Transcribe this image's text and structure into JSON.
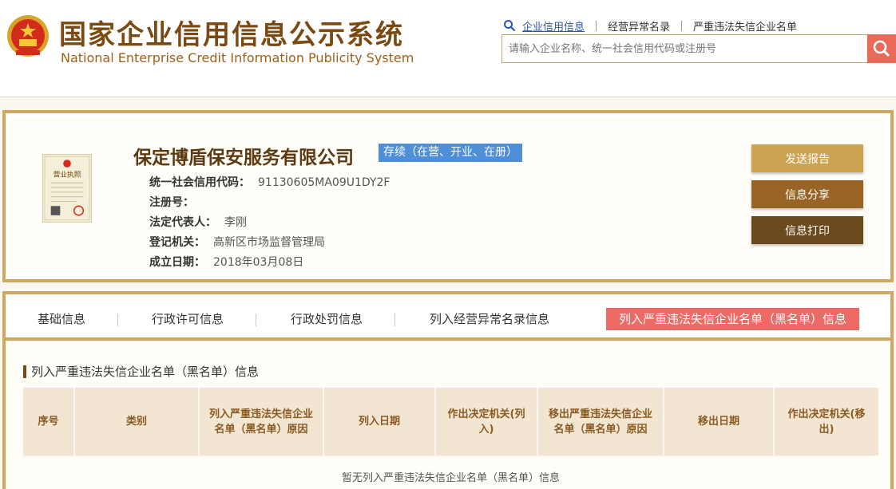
{
  "header": {
    "title_cn": "国家企业信用信息公示系统",
    "title_en": "National Enterprise Credit Information Publicity System",
    "links": [
      "企业信用信息",
      "经营异常名录",
      "严重违法失信企业名单"
    ],
    "search": {
      "placeholder": "请输入企业名称、统一社会信用代码或注册号"
    }
  },
  "company": {
    "name": "保定博盾保安服务有限公司",
    "status": "存续（在营、开业、在册）",
    "fields": [
      {
        "label": "统一社会信用代码：",
        "value": "91130605MA09U1DY2F"
      },
      {
        "label": "注册号：",
        "value": ""
      },
      {
        "label": "法定代表人：",
        "value": "李刚"
      },
      {
        "label": "登记机关：",
        "value": "高新区市场监督管理局"
      },
      {
        "label": "成立日期：",
        "value": "2018年03月08日"
      }
    ],
    "license_title": "营业执照",
    "buttons": {
      "send": "发送报告",
      "share": "信息分享",
      "print": "信息打印"
    }
  },
  "tabs": [
    "基础信息",
    "行政许可信息",
    "行政处罚信息",
    "列入经营异常名录信息",
    "列入严重违法失信企业名单（黑名单）信息"
  ],
  "section": {
    "title": "列入严重违法失信企业名单（黑名单）信息",
    "columns": [
      "序号",
      "类别",
      "列入严重违法失信企业名单（黑名单）原因",
      "列入日期",
      "作出决定机关(列入)",
      "移出严重违法失信企业名单（黑名单）原因",
      "移出日期",
      "作出决定机关(移出)"
    ],
    "empty_message": "暂无列入严重违法失信企业名单（黑名单）信息"
  },
  "colors": {
    "brand_brown": "#7a4a12",
    "gold_border": "#cfa75e",
    "active_tab": "#ee6a64",
    "status_blue": "#4e8fd8"
  }
}
